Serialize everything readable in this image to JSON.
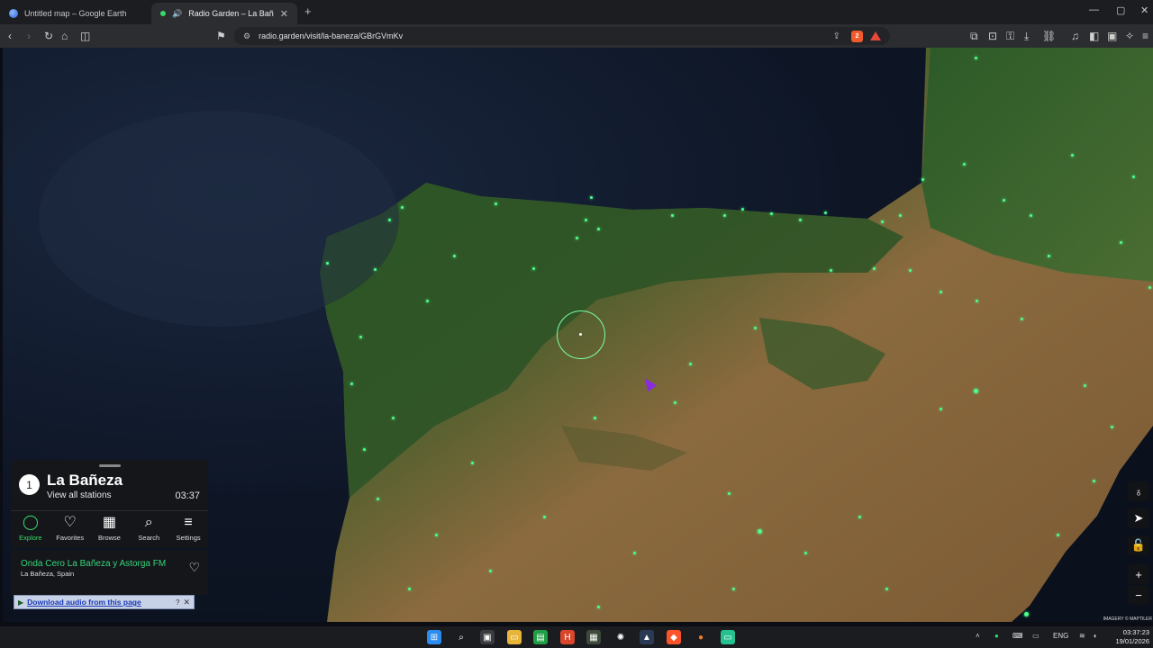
{
  "browser": {
    "tabs": [
      {
        "title": "Untitled map – Google Earth",
        "active": false,
        "icon": "google-earth-icon"
      },
      {
        "title": "Radio Garden – La Bañeza",
        "active": true,
        "icon": "speaker-icon"
      }
    ],
    "url": "radio.garden/visit/la-baneza/GBrGVmKv",
    "shield_count": "2"
  },
  "panel": {
    "station_count": "1",
    "place": "La Bañeza",
    "view_all": "View all stations",
    "time": "03:37",
    "nav": [
      {
        "label": "Explore",
        "icon": "compass-icon",
        "selected": true
      },
      {
        "label": "Favorites",
        "icon": "heart-icon",
        "selected": false
      },
      {
        "label": "Browse",
        "icon": "map-icon",
        "selected": false
      },
      {
        "label": "Search",
        "icon": "search-icon",
        "selected": false
      },
      {
        "label": "Settings",
        "icon": "menu-icon",
        "selected": false
      }
    ]
  },
  "station": {
    "name": "Onda Cero La Bañeza y Astorga FM",
    "location": "La Bañeza, Spain"
  },
  "download_bar": {
    "label": "Download audio from this page",
    "help": "?",
    "close": "✕"
  },
  "map": {
    "attribution": "IMAGERY © MAPTILER"
  },
  "taskbar": {
    "language": "ENG",
    "time": "03:37:23",
    "date": "19/01/2026"
  },
  "colors": {
    "accent": "#36d96b",
    "station_dot": "#4dff8a"
  }
}
